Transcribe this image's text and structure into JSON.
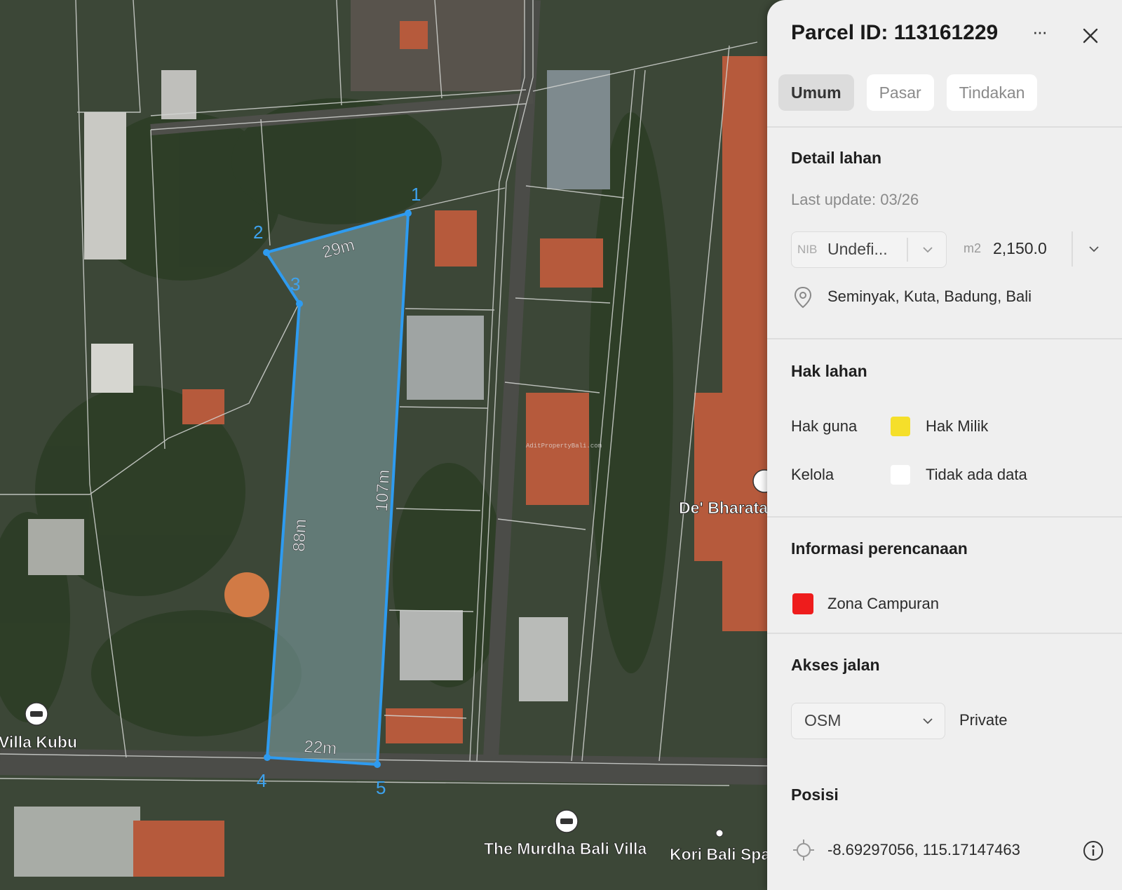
{
  "map": {
    "vertices": [
      {
        "label": "1"
      },
      {
        "label": "2"
      },
      {
        "label": "3"
      },
      {
        "label": "4"
      },
      {
        "label": "5"
      }
    ],
    "edges": [
      {
        "label": "29m"
      },
      {
        "label": "88m"
      },
      {
        "label": "107m"
      },
      {
        "label": "22m"
      }
    ],
    "places": [
      {
        "name": "Villa Kubu"
      },
      {
        "name": "De' Bharata"
      },
      {
        "name": "The Murdha Bali Villa"
      },
      {
        "name": "Kori Bali Spa"
      }
    ],
    "watermark": "AditPropertyBali.com",
    "parcel_color": "#2e9bf0"
  },
  "panel": {
    "title": "Parcel ID: 113161229",
    "more_label": "···",
    "tabs": [
      {
        "label": "Umum",
        "active": true
      },
      {
        "label": "Pasar",
        "active": false
      },
      {
        "label": "Tindakan",
        "active": false
      }
    ],
    "detail": {
      "heading": "Detail lahan",
      "last_update": "Last update: 03/26",
      "nib_prefix": "NIB",
      "nib_value": "Undefi...",
      "area_unit": "m2",
      "area_value": "2,150.0",
      "location": "Seminyak, Kuta, Badung, Bali"
    },
    "rights": {
      "heading": "Hak lahan",
      "rows": [
        {
          "label": "Hak guna",
          "value": "Hak Milik",
          "color": "#f5df2a"
        },
        {
          "label": "Kelola",
          "value": "Tidak ada data",
          "color": "#ffffff"
        }
      ]
    },
    "planning": {
      "heading": "Informasi perencanaan",
      "zone": "Zona Campuran",
      "color": "#ee1c1c"
    },
    "access": {
      "heading": "Akses jalan",
      "source": "OSM",
      "value": "Private"
    },
    "position": {
      "heading": "Posisi",
      "coords": "-8.69297056, 115.17147463"
    }
  }
}
